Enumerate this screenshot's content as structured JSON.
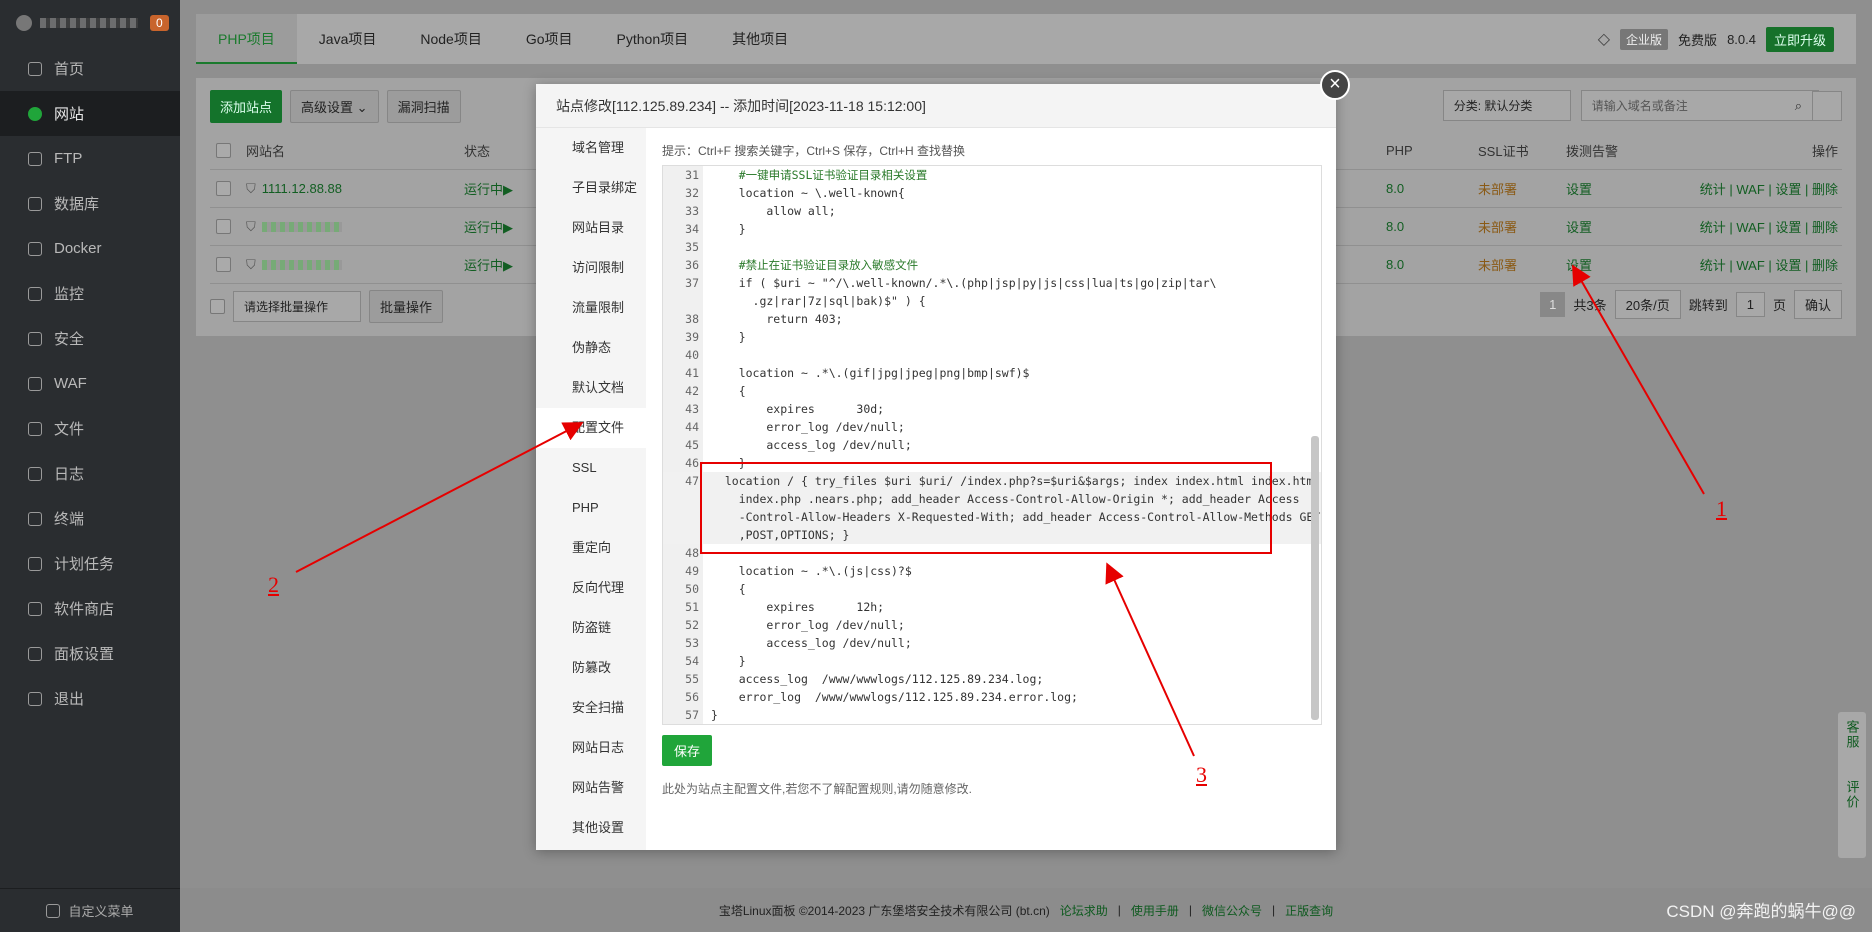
{
  "sidebar": {
    "badge": "0",
    "items": [
      {
        "label": "首页",
        "icon": "home-icon"
      },
      {
        "label": "网站",
        "icon": "globe-icon"
      },
      {
        "label": "FTP",
        "icon": "ftp-icon"
      },
      {
        "label": "数据库",
        "icon": "database-icon"
      },
      {
        "label": "Docker",
        "icon": "docker-icon"
      },
      {
        "label": "监控",
        "icon": "monitor-icon"
      },
      {
        "label": "安全",
        "icon": "shield-icon"
      },
      {
        "label": "WAF",
        "icon": "waf-icon"
      },
      {
        "label": "文件",
        "icon": "folder-icon"
      },
      {
        "label": "日志",
        "icon": "log-icon"
      },
      {
        "label": "终端",
        "icon": "terminal-icon"
      },
      {
        "label": "计划任务",
        "icon": "clock-icon"
      },
      {
        "label": "软件商店",
        "icon": "grid-icon"
      },
      {
        "label": "面板设置",
        "icon": "gear-icon"
      },
      {
        "label": "退出",
        "icon": "logout-icon"
      }
    ],
    "footer": "自定义菜单"
  },
  "topbar": {
    "tabs": [
      "PHP项目",
      "Java项目",
      "Node项目",
      "Go项目",
      "Python项目",
      "其他项目"
    ],
    "enterprise": "企业版",
    "free": "免费版",
    "version": "8.0.4",
    "upgrade": "立即升级"
  },
  "toolbar": {
    "add_site": "添加站点",
    "advanced": "高级设置",
    "scan": "漏洞扫描",
    "category": "分类: 默认分类",
    "search_placeholder": "请输入域名或备注"
  },
  "table": {
    "headers": {
      "name": "网站名",
      "status": "状态",
      "php": "PHP",
      "ssl": "SSL证书",
      "alert": "拨测告警",
      "ops": "操作"
    },
    "rows": [
      {
        "name": "1111.12.88.88",
        "status": "运行中▶",
        "php": "8.0",
        "ssl": "未部署",
        "alert": "设置",
        "ops": "统计 | WAF | 设置 | 删除"
      },
      {
        "name": "",
        "status": "运行中▶",
        "php": "8.0",
        "ssl": "未部署",
        "alert": "设置",
        "ops": "统计 | WAF | 设置 | 删除"
      },
      {
        "name": "",
        "status": "运行中▶",
        "php": "8.0",
        "ssl": "未部署",
        "alert": "设置",
        "ops": "统计 | WAF | 设置 | 删除"
      }
    ],
    "batch_placeholder": "请选择批量操作",
    "batch_btn": "批量操作",
    "pager": {
      "page": "1",
      "total": "共3条",
      "per_page": "20条/页",
      "jump": "跳转到",
      "jump_page": "1",
      "page_unit": "页",
      "confirm": "确认"
    }
  },
  "modal": {
    "title": "站点修改[112.125.89.234] -- 添加时间[2023-11-18 15:12:00]",
    "nav": [
      "域名管理",
      "子目录绑定",
      "网站目录",
      "访问限制",
      "流量限制",
      "伪静态",
      "默认文档",
      "配置文件",
      "SSL",
      "PHP",
      "重定向",
      "反向代理",
      "防盗链",
      "防篡改",
      "安全扫描",
      "网站日志",
      "网站告警",
      "其他设置"
    ],
    "hint": "提示：Ctrl+F 搜索关键字，Ctrl+S 保存，Ctrl+H 查找替换",
    "code": [
      {
        "n": "31",
        "t": "    #一键申请SSL证书验证目录相关设置"
      },
      {
        "n": "32",
        "t": "    location ~ \\.well-known{"
      },
      {
        "n": "33",
        "t": "        allow all;"
      },
      {
        "n": "34",
        "t": "    }"
      },
      {
        "n": "35",
        "t": ""
      },
      {
        "n": "36",
        "t": "    #禁止在证书验证目录放入敏感文件"
      },
      {
        "n": "37",
        "t": "    if ( $uri ~ \"^/\\.well-known/.*\\.(php|jsp|py|js|css|lua|ts|go|zip|tar\\"
      },
      {
        "n": "",
        "t": "      .gz|rar|7z|sql|bak)$\" ) {"
      },
      {
        "n": "38",
        "t": "        return 403;"
      },
      {
        "n": "39",
        "t": "    }"
      },
      {
        "n": "40",
        "t": ""
      },
      {
        "n": "41",
        "t": "    location ~ .*\\.(gif|jpg|jpeg|png|bmp|swf)$"
      },
      {
        "n": "42",
        "t": "    {"
      },
      {
        "n": "43",
        "t": "        expires      30d;"
      },
      {
        "n": "44",
        "t": "        error_log /dev/null;"
      },
      {
        "n": "45",
        "t": "        access_log /dev/null;"
      },
      {
        "n": "46",
        "t": "    }"
      },
      {
        "n": "47",
        "t": "  location / { try_files $uri $uri/ /index.php?s=$uri&$args; index index.html index.htm"
      },
      {
        "n": "",
        "t": "    index.php .nears.php; add_header Access-Control-Allow-Origin *; add_header Access"
      },
      {
        "n": "",
        "t": "    -Control-Allow-Headers X-Requested-With; add_header Access-Control-Allow-Methods GET"
      },
      {
        "n": "",
        "t": "    ,POST,OPTIONS; }"
      },
      {
        "n": "48",
        "t": ""
      },
      {
        "n": "49",
        "t": "    location ~ .*\\.(js|css)?$"
      },
      {
        "n": "50",
        "t": "    {"
      },
      {
        "n": "51",
        "t": "        expires      12h;"
      },
      {
        "n": "52",
        "t": "        error_log /dev/null;"
      },
      {
        "n": "53",
        "t": "        access_log /dev/null;"
      },
      {
        "n": "54",
        "t": "    }"
      },
      {
        "n": "55",
        "t": "    access_log  /www/wwwlogs/112.125.89.234.log;"
      },
      {
        "n": "56",
        "t": "    error_log  /www/wwwlogs/112.125.89.234.error.log;"
      },
      {
        "n": "57",
        "t": "}"
      }
    ],
    "save": "保存",
    "note": "此处为站点主配置文件,若您不了解配置规则,请勿随意修改."
  },
  "footer": {
    "copyright": "宝塔Linux面板 ©2014-2023 广东堡塔安全技术有限公司 (bt.cn)",
    "links": [
      "论坛求助",
      "使用手册",
      "微信公众号",
      "正版查询"
    ]
  },
  "float": {
    "service": "客服",
    "review": "评价"
  },
  "annotations": {
    "a1": "1",
    "a2": "2",
    "a3": "3"
  },
  "watermark": "CSDN @奔跑的蜗牛@@"
}
